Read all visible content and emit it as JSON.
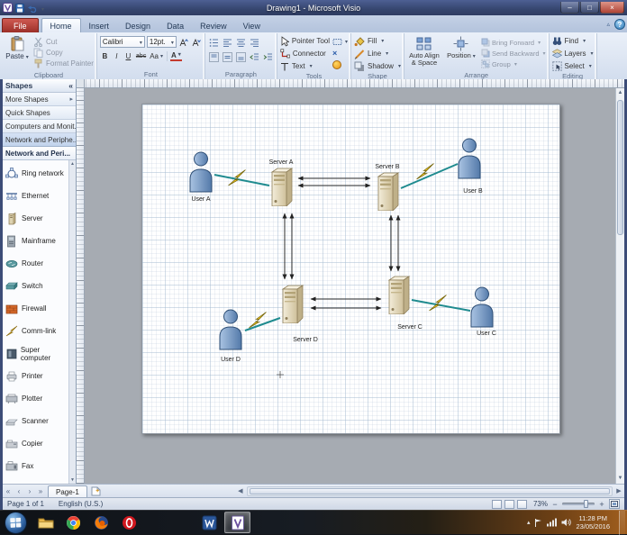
{
  "window": {
    "title": "Drawing1 - Microsoft Visio",
    "controls": {
      "minimize": "–",
      "maximize": "□",
      "close": "×"
    }
  },
  "tabs": {
    "file": "File",
    "items": [
      "Home",
      "Insert",
      "Design",
      "Data",
      "Review",
      "View"
    ],
    "active": "Home",
    "help": "?"
  },
  "ribbon": {
    "clipboard": {
      "label": "Clipboard",
      "paste": "Paste",
      "cut": "Cut",
      "copy": "Copy",
      "format_painter": "Format Painter"
    },
    "font": {
      "label": "Font",
      "family": "Calibri",
      "size": "12pt.",
      "bold": "B",
      "italic": "I",
      "underline": "U",
      "strike": "abc",
      "case_btn": "Aa",
      "color_btn": "A"
    },
    "paragraph": {
      "label": "Paragraph"
    },
    "tools": {
      "label": "Tools",
      "pointer": "Pointer Tool",
      "connector": "Connector",
      "text": "Text"
    },
    "shape": {
      "label": "Shape",
      "fill": "Fill",
      "line": "Line",
      "shadow": "Shadow"
    },
    "arrange": {
      "label": "Arrange",
      "auto_align": "Auto Align & Space",
      "position": "Position",
      "bring_forward": "Bring Forward",
      "send_backward": "Send Backward",
      "group": "Group"
    },
    "editing": {
      "label": "Editing",
      "find": "Find",
      "layers": "Layers",
      "select": "Select"
    }
  },
  "shapes_panel": {
    "header": "Shapes",
    "collapse": "«",
    "sections": [
      "More Shapes",
      "Quick Shapes",
      "Computers and Monit...",
      "Network and Periphe..."
    ],
    "stencil_title": "Network and Peri...",
    "items": [
      "Ring network",
      "Ethernet",
      "Server",
      "Mainframe",
      "Router",
      "Switch",
      "Firewall",
      "Comm-link",
      "Super computer",
      "Printer",
      "Plotter",
      "Scanner",
      "Copier",
      "Fax"
    ]
  },
  "diagram": {
    "users": {
      "a": "User A",
      "b": "User B",
      "c": "User C",
      "d": "User D"
    },
    "servers": {
      "a": "Server A",
      "b": "Server B",
      "c": "Server C",
      "d": "Server D"
    }
  },
  "page_tabs": {
    "first": "«",
    "prev": "‹",
    "next": "›",
    "last": "»",
    "page1": "Page-1"
  },
  "status_bar": {
    "page": "Page 1 of 1",
    "language": "English (U.S.)",
    "zoom": "73%",
    "zoom_out": "−",
    "zoom_in": "+"
  },
  "taskbar": {
    "time": "11:28 PM",
    "date": "23/05/2016"
  }
}
